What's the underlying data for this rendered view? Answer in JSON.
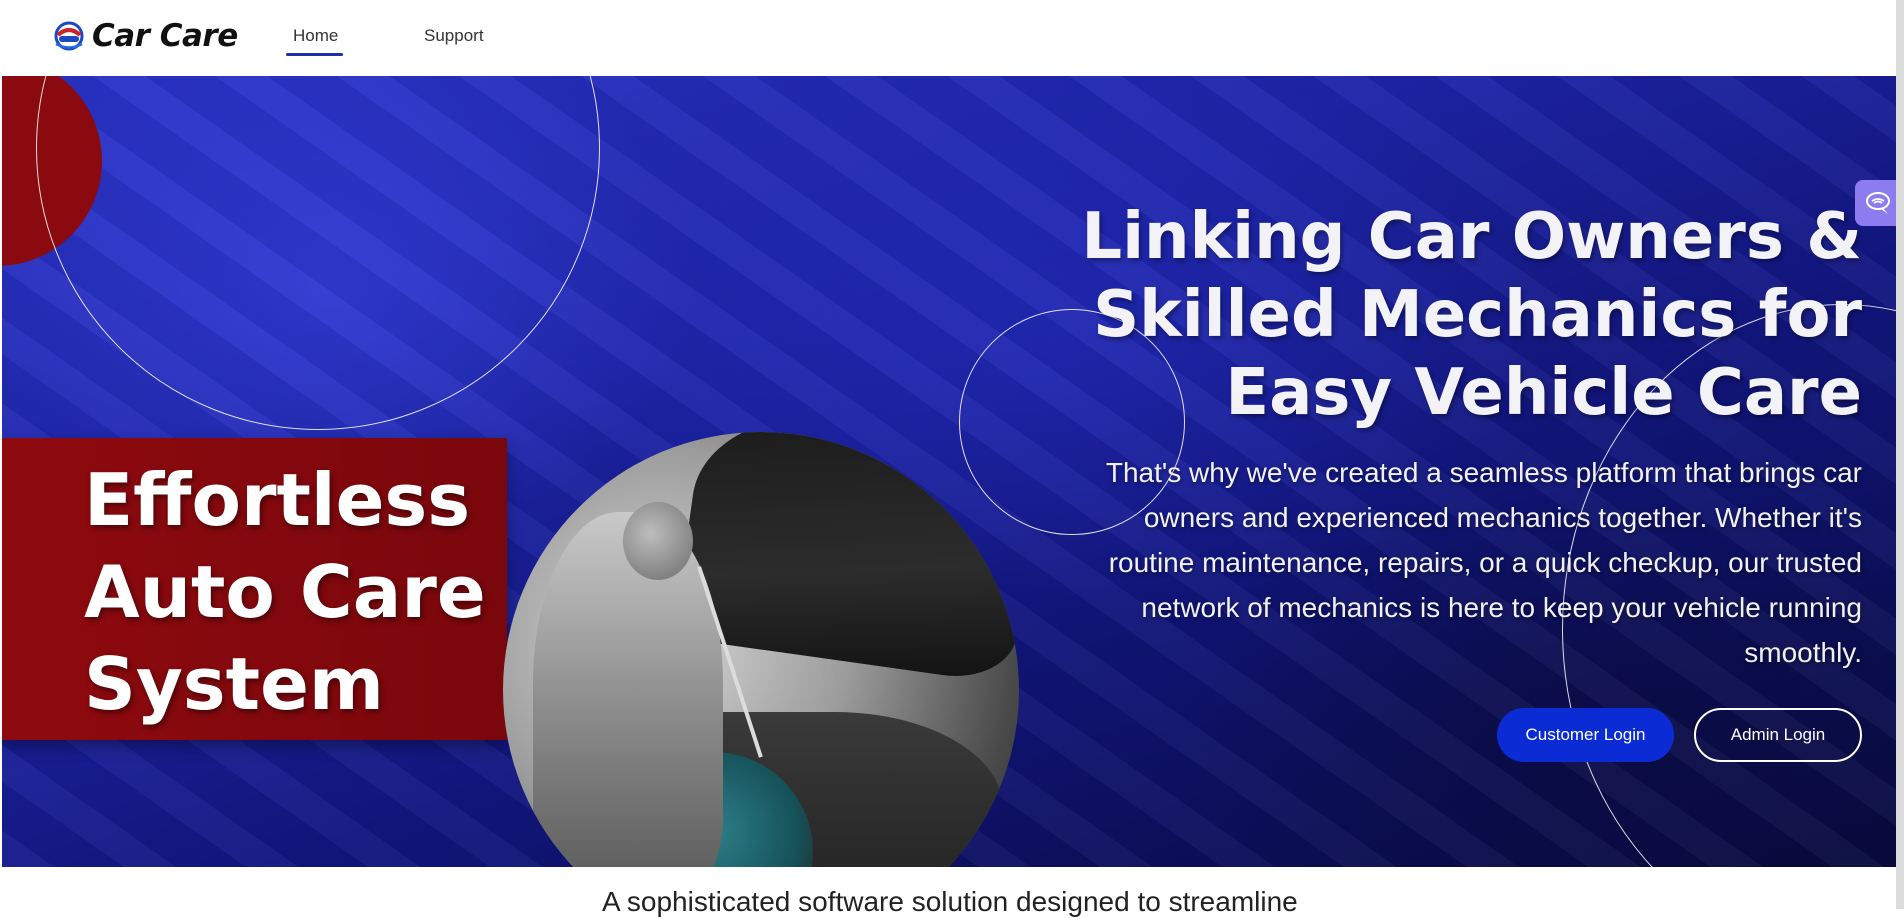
{
  "navbar": {
    "brand_name": "Car Care",
    "logo_icon": "car-care-logo-icon",
    "links": [
      {
        "label": "Home",
        "active": true
      },
      {
        "label": "Support",
        "active": false
      }
    ],
    "accent_color": "#1b2fa6"
  },
  "hero": {
    "left_title": "Effortless Auto Care System",
    "title": "Linking Car Owners & Skilled Mechanics for Easy Vehicle Care",
    "description": "That's why we've created a seamless platform that brings car owners and experienced mechanics together. Whether it's routine maintenance, repairs, or a quick checkup, our trusted network of mechanics is here to keep your vehicle running smoothly.",
    "buttons": {
      "customer_login": "Customer Login",
      "admin_login": "Admin Login"
    },
    "colors": {
      "primary_blue": "#0b2bd4",
      "panel_red": "#8e0a0f",
      "background_blue": "#1d24a8"
    }
  },
  "side_widget": {
    "icon": "chat-bubble-icon"
  },
  "below_hero": {
    "text": "A sophisticated software solution designed to streamline"
  }
}
